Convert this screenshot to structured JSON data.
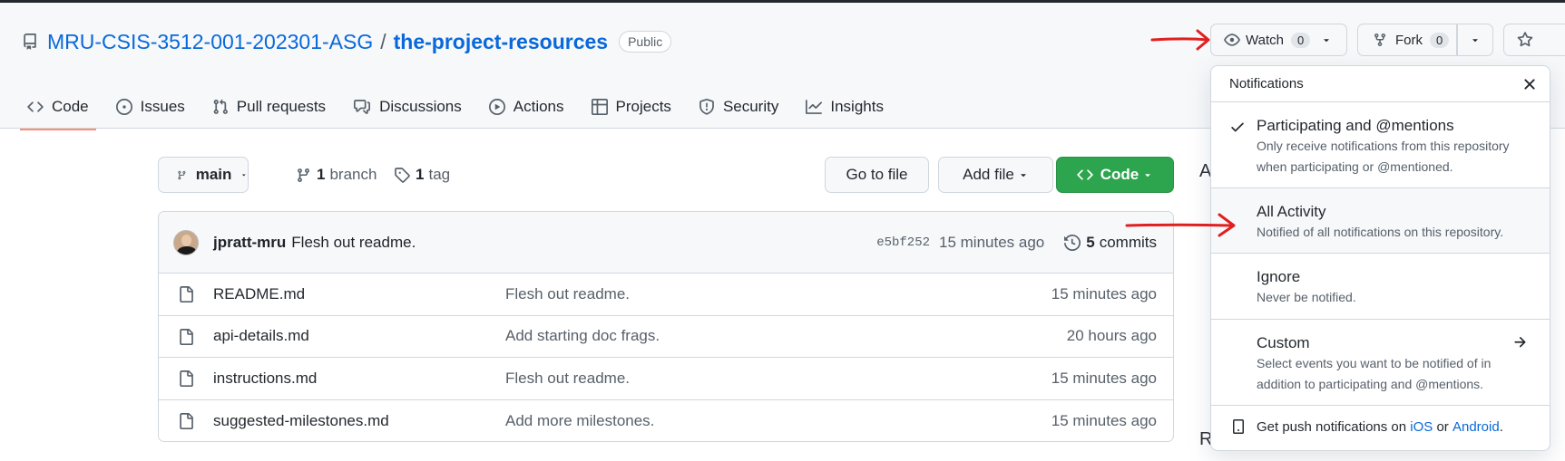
{
  "repo": {
    "owner": "MRU-CSIS-3512-001-202301-ASG",
    "separator": "/",
    "name": "the-project-resources",
    "visibility": "Public"
  },
  "header_actions": {
    "watch_label": "Watch",
    "watch_count": "0",
    "fork_label": "Fork",
    "fork_count": "0"
  },
  "tabs": [
    {
      "label": "Code",
      "icon": "code-icon",
      "active": true
    },
    {
      "label": "Issues",
      "icon": "issue-opened-icon"
    },
    {
      "label": "Pull requests",
      "icon": "git-pull-request-icon"
    },
    {
      "label": "Discussions",
      "icon": "comment-discussion-icon"
    },
    {
      "label": "Actions",
      "icon": "play-icon"
    },
    {
      "label": "Projects",
      "icon": "table-icon"
    },
    {
      "label": "Security",
      "icon": "shield-icon"
    },
    {
      "label": "Insights",
      "icon": "graph-icon"
    }
  ],
  "branch_bar": {
    "branch": "main",
    "branch_count": "1",
    "branch_word": "branch",
    "tag_count": "1",
    "tag_word": "tag",
    "goto_label": "Go to file",
    "add_file_label": "Add file",
    "code_label": "Code"
  },
  "latest_commit": {
    "author": "jpratt-mru",
    "message": "Flesh out readme.",
    "sha": "e5bf252",
    "time": "15 minutes ago",
    "commit_count": "5",
    "commit_word": "commits"
  },
  "files": [
    {
      "name": "README.md",
      "message": "Flesh out readme.",
      "time": "15 minutes ago"
    },
    {
      "name": "api-details.md",
      "message": "Add starting doc frags.",
      "time": "20 hours ago"
    },
    {
      "name": "instructions.md",
      "message": "Flesh out readme.",
      "time": "15 minutes ago"
    },
    {
      "name": "suggested-milestones.md",
      "message": "Add more milestones.",
      "time": "15 minutes ago"
    }
  ],
  "sidebar_peek": {
    "about_letter": "A",
    "readme_letter": "R"
  },
  "notifications": {
    "title": "Notifications",
    "options": [
      {
        "title": "Participating and @mentions",
        "desc": "Only receive notifications from this repository when participating or @mentioned.",
        "checked": true
      },
      {
        "title": "All Activity",
        "desc": "Notified of all notifications on this repository.",
        "hovered": true
      },
      {
        "title": "Ignore",
        "desc": "Never be notified."
      },
      {
        "title": "Custom",
        "desc": "Select events you want to be notified of in addition to participating and @mentions.",
        "has_arrow": true
      }
    ],
    "footer_prefix": "Get push notifications on",
    "footer_ios": "iOS",
    "footer_or": "or",
    "footer_android": "Android",
    "footer_suffix": "."
  },
  "colors": {
    "link_blue": "#0969da",
    "code_button_green": "#2da44e",
    "active_tab_underline": "#fd8c73",
    "annotation_red": "#e02020"
  }
}
